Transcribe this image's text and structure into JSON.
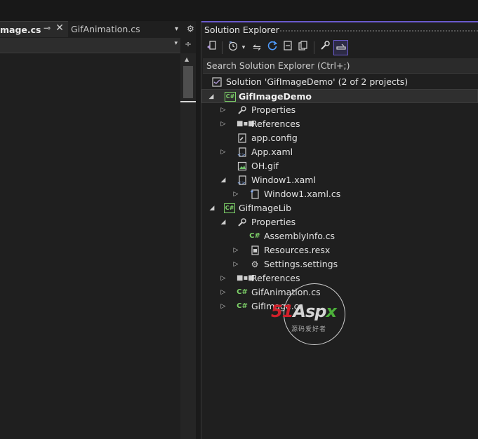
{
  "editor": {
    "active_tab": "mage.cs",
    "inactive_tab": "GifAnimation.cs",
    "pin_glyph": "⊸",
    "close_glyph": "✕",
    "overflow_glyph": "▾",
    "settings_glyph": "⚙",
    "nav_dropdown_glyph": "▾",
    "split_glyph": "÷"
  },
  "solution_explorer": {
    "title": "Solution Explorer",
    "accent_color": "#6a5acd",
    "search_placeholder": "Search Solution Explorer (Ctrl+;)",
    "toolbar": [
      {
        "icon": "sync-with-active-document-icon"
      },
      {
        "icon": "pending-changes-filter-icon"
      },
      {
        "icon": "dropdown-icon"
      },
      {
        "icon": "back-forward-icon"
      },
      {
        "icon": "refresh-icon"
      },
      {
        "icon": "collapse-all-icon"
      },
      {
        "icon": "show-all-files-icon"
      },
      {
        "icon": "properties-wrench-icon"
      },
      {
        "icon": "preview-selected-items-icon",
        "selected": true
      }
    ],
    "tree": {
      "solution": "Solution 'GifImageDemo' (2 of 2 projects)",
      "project1": "GifImageDemo",
      "p1_properties": "Properties",
      "p1_references": "References",
      "p1_app_config": "app.config",
      "p1_app_xaml": "App.xaml",
      "p1_oh_gif": "OH.gif",
      "p1_window1": "Window1.xaml",
      "p1_window1_cs": "Window1.xaml.cs",
      "project2": "GifImageLib",
      "p2_properties": "Properties",
      "p2_assemblyinfo": "AssemblyInfo.cs",
      "p2_resources": "Resources.resx",
      "p2_settings": "Settings.settings",
      "p2_references": "References",
      "p2_gifanimation": "GifAnimation.cs",
      "p2_gifimage": "GifImage.cs"
    }
  },
  "watermark": {
    "part1": "51",
    "part2": "Asp",
    "part3": "x",
    "subtitle": "源码爱好者"
  }
}
